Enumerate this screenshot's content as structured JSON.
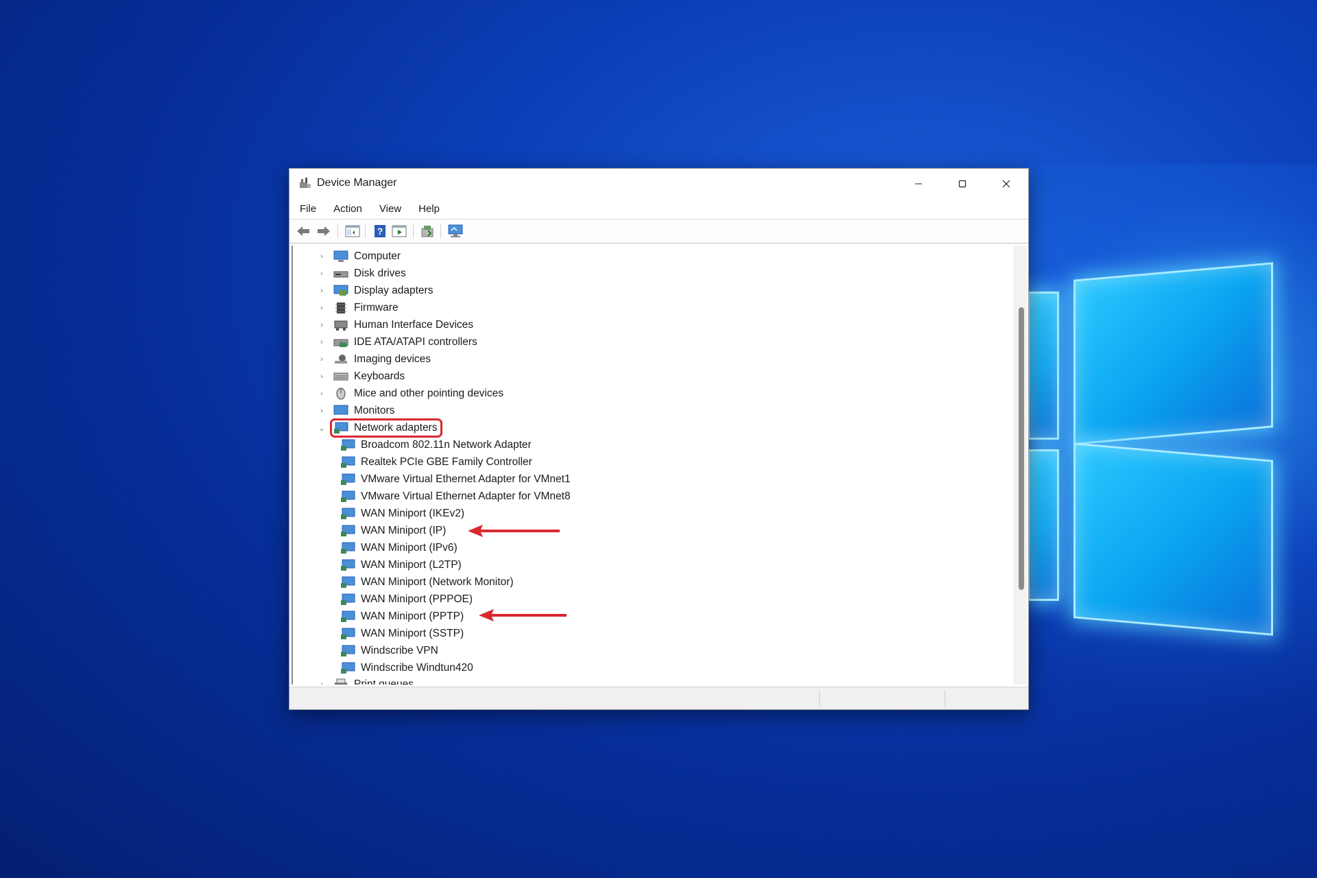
{
  "window": {
    "title": "Device Manager",
    "controls": {
      "minimize": "—",
      "maximize": "☐",
      "close": "✕"
    }
  },
  "menu": [
    "File",
    "Action",
    "View",
    "Help"
  ],
  "toolbar": [
    "back-icon",
    "forward-icon",
    "properties-console-icon",
    "help-icon",
    "run-icon",
    "update-driver-icon",
    "scan-hardware-icon"
  ],
  "tree": {
    "categories": [
      {
        "label": "Computer",
        "icon": "computer-icon",
        "expanded": false
      },
      {
        "label": "Disk drives",
        "icon": "disk-drive-icon",
        "expanded": false
      },
      {
        "label": "Display adapters",
        "icon": "display-adapter-icon",
        "expanded": false
      },
      {
        "label": "Firmware",
        "icon": "firmware-icon",
        "expanded": false
      },
      {
        "label": "Human Interface Devices",
        "icon": "hid-icon",
        "expanded": false
      },
      {
        "label": "IDE ATA/ATAPI controllers",
        "icon": "ide-controller-icon",
        "expanded": false
      },
      {
        "label": "Imaging devices",
        "icon": "imaging-device-icon",
        "expanded": false
      },
      {
        "label": "Keyboards",
        "icon": "keyboard-icon",
        "expanded": false
      },
      {
        "label": "Mice and other pointing devices",
        "icon": "mouse-icon",
        "expanded": false
      },
      {
        "label": "Monitors",
        "icon": "monitor-icon",
        "expanded": false
      },
      {
        "label": "Network adapters",
        "icon": "network-adapter-icon",
        "expanded": true,
        "selected": true
      }
    ],
    "network_children": [
      "Broadcom 802.11n Network Adapter",
      "Realtek PCIe GBE Family Controller",
      "VMware Virtual Ethernet Adapter for VMnet1",
      "VMware Virtual Ethernet Adapter for VMnet8",
      "WAN Miniport (IKEv2)",
      "WAN Miniport (IP)",
      "WAN Miniport (IPv6)",
      "WAN Miniport (L2TP)",
      "WAN Miniport (Network Monitor)",
      "WAN Miniport (PPPOE)",
      "WAN Miniport (PPTP)",
      "WAN Miniport (SSTP)",
      "Windscribe VPN",
      "Windscribe Windtun420"
    ],
    "after": [
      {
        "label": "Print queues",
        "icon": "printer-icon",
        "expanded": false
      }
    ]
  },
  "annotations": {
    "highlight_color": "#d9282f",
    "arrows_point_to": [
      "WAN Miniport (IP)",
      "WAN Miniport (PPTP)"
    ]
  },
  "colors": {
    "desktop_bg": "#0b3fb8",
    "logo_glow": "#2cc8ff"
  }
}
